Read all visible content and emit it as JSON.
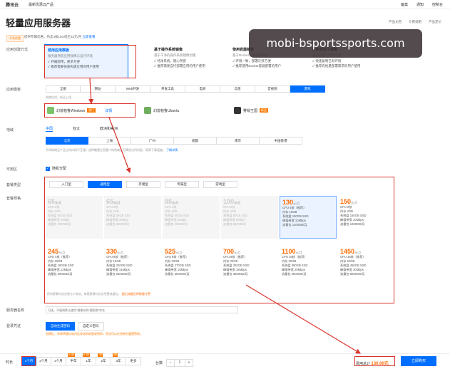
{
  "topbar": {
    "logo": "腾讯云",
    "nav": "最新优惠云产品",
    "right": [
      "备案",
      "通知",
      "控制台"
    ]
  },
  "page": {
    "title": "轻量应用服务器",
    "links": [
      "产品文档",
      "计费说明",
      "产品定价"
    ]
  },
  "hint": {
    "tag": "开发优惠",
    "text": "提供专属优惠，热卖4核16G低至32元/月",
    "link": "立即查看"
  },
  "labels": {
    "mode": "应用创建方式",
    "image": "应用模板",
    "region": "地域",
    "zone": "可用区",
    "pkg": "套餐类型",
    "plan": "套餐规格",
    "name": "服务器名称",
    "login": "登录凭证",
    "duration": "时长",
    "qty": "台数"
  },
  "modes": [
    {
      "title": "使用应用模板",
      "desc": "服务器预装应用镜像与运行环境",
      "feats": [
        "✓ 开箱即用，简单方便",
        "✓ 推荐需要快速构建应用的用户使用"
      ]
    },
    {
      "title": "基于操作系统镜像",
      "desc": "基于干净的操作系统镜像创建",
      "feats": [
        "✓ 纯净系统，随心所欲",
        "✓ 推荐需要自行部署应用的用户使用"
      ]
    },
    {
      "title": "使用容器镜像",
      "desc": "基于Docker容器镜像创建",
      "feats": [
        "✓ 环境一致，部署迁移方便",
        "✓ 推荐使用Docker容器部署的用户"
      ]
    },
    {
      "title": "使用自定义镜像",
      "desc": "基于自定义镜像创建",
      "feats": [
        "✓ 快速复制已有环境",
        "✓ 推荐有批量部署需求的用户使用"
      ]
    }
  ],
  "image_tabs": [
    "全部",
    "网站",
    "Web开发",
    "开发工具",
    "电商",
    "云盘",
    "音视频",
    "游戏"
  ],
  "image_sub": "热销应用，新品上线",
  "images": [
    {
      "name": "幻兽帕鲁Windows",
      "badge": "热门",
      "link": "详情"
    },
    {
      "name": "幻兽帕鲁Ubuntu",
      "badge": "",
      "link": ""
    },
    {
      "name": "雾锁王国",
      "badge": "新品",
      "link": ""
    }
  ],
  "region_tabs": [
    "中国",
    "亚太",
    "欧洲和美洲"
  ],
  "cities": [
    "北京",
    "上海",
    "广州",
    "成都",
    "南京",
    "中国香港"
  ],
  "region_note": "不同地域云产品之间内网不互通；选择最靠近您客户的地域，可降低访问时延，提高下载速度。",
  "region_link": "了解详情",
  "zone_label": "随机分配",
  "pkg_tabs": [
    "入门型",
    "通用型",
    "存储型",
    "专属型",
    "游戏型"
  ],
  "plans_top": [
    {
      "price": "65",
      "unit": "元/月",
      "specs": [
        "CPU 2核",
        "内存 2GB",
        "系统盘 50GB SSD",
        "峰值带宽 4Mbps",
        "流量包 300GB/月"
      ]
    },
    {
      "price": "65",
      "unit": "元/月",
      "specs": [
        "CPU 2核",
        "内存 2GB",
        "系统盘 50GB SSD",
        "峰值带宽 4Mbps",
        "流量包 300GB/月"
      ]
    },
    {
      "price": "95",
      "unit": "元/月",
      "specs": [
        "CPU 2核",
        "内存 4GB",
        "系统盘 60GB SSD",
        "峰值带宽 5Mbps",
        "流量包 500GB/月"
      ]
    },
    {
      "price": "100",
      "unit": "元/月",
      "specs": [
        "CPU 2核",
        "内存 4GB",
        "系统盘 80GB SSD",
        "峰值带宽 6Mbps",
        "流量包 800GB/月"
      ]
    },
    {
      "price": "130",
      "unit": "元/月",
      "specs": [
        "CPU 4核（推荐）",
        "内存 16GB",
        "系统盘 100GB SSD",
        "峰值带宽 10Mbps",
        "流量包 1200GB/月"
      ]
    },
    {
      "price": "150",
      "unit": "元/月",
      "specs": [
        "CPU 2核",
        "内存 4GB",
        "系统盘 150GB SSD",
        "峰值带宽 10Mbps",
        "流量包 1200GB/月"
      ]
    }
  ],
  "plans_bottom": [
    {
      "price": "245",
      "unit": "元/月",
      "specs": [
        "CPU 4核（推荐）",
        "内存 16GB",
        "系统盘 180GB SSD",
        "峰值带宽 12Mbps",
        "流量包 2000GB/月"
      ]
    },
    {
      "price": "330",
      "unit": "元/月",
      "specs": [
        "CPU 8核（推荐）",
        "内存 16GB",
        "系统盘 220GB SSD",
        "峰值带宽 14Mbps",
        "流量包 2500GB/月"
      ]
    },
    {
      "price": "525",
      "unit": "元/月",
      "specs": [
        "CPU 8核（推荐）",
        "内存 32GB",
        "系统盘 270GB SSD",
        "峰值带宽 16Mbps",
        "流量包 3000GB/月"
      ]
    },
    {
      "price": "700",
      "unit": "元/月",
      "specs": [
        "CPU 8核（推荐）",
        "内存 32GB",
        "系统盘 320GB SSD",
        "峰值带宽 18Mbps",
        "流量包 3500GB/月"
      ]
    },
    {
      "price": "1100",
      "unit": "元/月",
      "specs": [
        "CPU 16核（推荐）",
        "内存 32GB",
        "系统盘 380GB SSD",
        "峰值带宽 20Mbps",
        "流量包 4500GB/月"
      ]
    },
    {
      "price": "1450",
      "unit": "元/月",
      "specs": [
        "CPU 16核（推荐）",
        "内存 64GB",
        "系统盘 450GB SSD",
        "峰值带宽 30Mbps",
        "流量包 6000GB/月"
      ]
    }
  ],
  "plan_note": "所有套餐均包含独立IP地址，每套套餐均包含免费流量包。",
  "plan_note_link": "超出流量后将按量计费",
  "name_placeholder": "可选，不填则默认使用“镜像名称-随机数”命名",
  "login_btns": [
    "自动生成密码",
    "自定义密码"
  ],
  "login_note": "创建后，系统将通过站内信发送初始登录密码，您也可以在控制台重置密码。",
  "durations": [
    {
      "label": "1个月",
      "disc": ""
    },
    {
      "label": "2个月",
      "disc": ""
    },
    {
      "label": "3个月",
      "disc": ""
    },
    {
      "label": "半年",
      "disc": "9.5折"
    },
    {
      "label": "1年",
      "disc": "8.3折"
    },
    {
      "label": "2年",
      "disc": "7折"
    },
    {
      "label": "3年",
      "disc": "6折"
    },
    {
      "label": "更多",
      "disc": ""
    }
  ],
  "qty": {
    "minus": "−",
    "value": "1",
    "plus": "+"
  },
  "total": {
    "label": "费用总计",
    "value": "130.00元"
  },
  "buy": "立即购买",
  "watermark": "mobi-bsportssports.com"
}
